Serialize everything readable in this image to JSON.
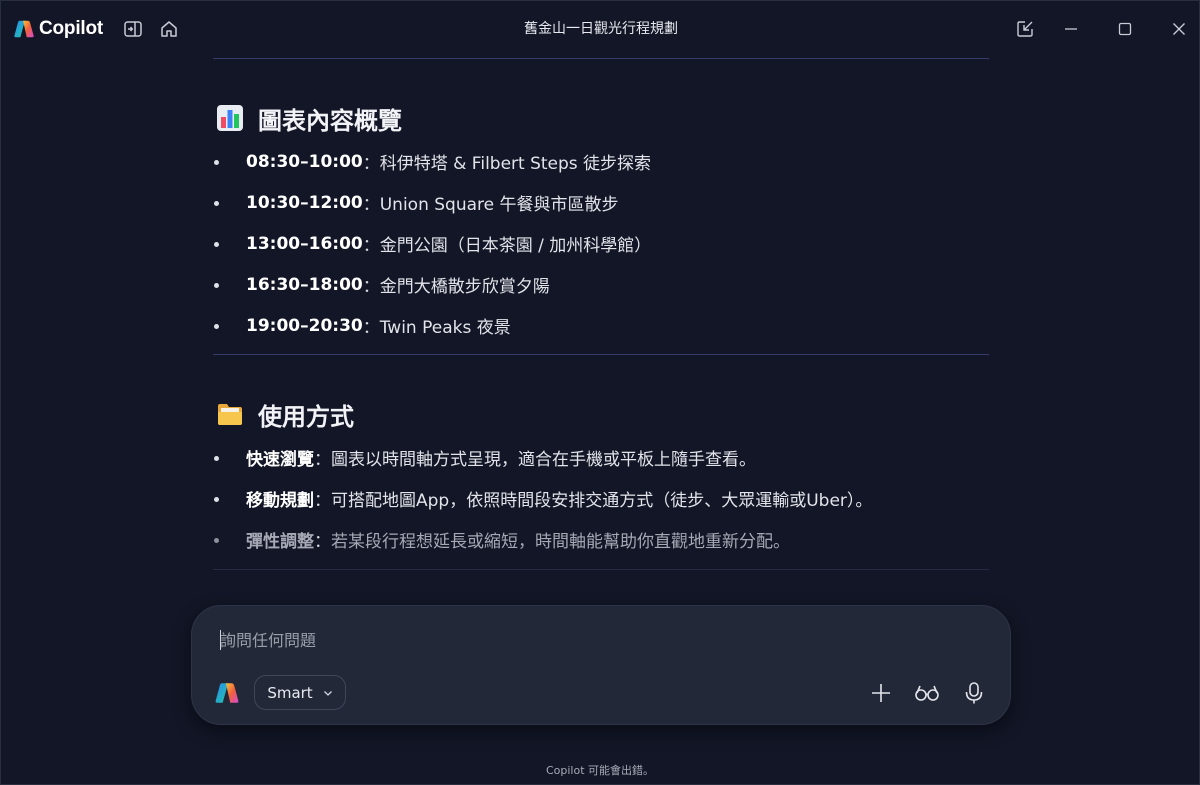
{
  "app": {
    "name": "Copilot",
    "window_title": "舊金山一日觀光行程規劃"
  },
  "sections": [
    {
      "heading": "圖表內容概覽",
      "icon": "bar-chart-emoji",
      "items": [
        {
          "label": "08:30–10:00",
          "sep": "：",
          "text": "科伊特塔 & Filbert Steps 徒步探索"
        },
        {
          "label": "10:30–12:00",
          "sep": "：",
          "text": "Union Square 午餐與市區散步"
        },
        {
          "label": "13:00–16:00",
          "sep": "：",
          "text": "金門公園（日本茶園 / 加州科學館）"
        },
        {
          "label": "16:30–18:00",
          "sep": "：",
          "text": "金門大橋散步欣賞夕陽"
        },
        {
          "label": "19:00–20:30",
          "sep": "：",
          "text": "Twin Peaks 夜景"
        }
      ]
    },
    {
      "heading": "使用方式",
      "icon": "folder-emoji",
      "items": [
        {
          "label": "快速瀏覽",
          "sep": "：",
          "text": "圖表以時間軸方式呈現，適合在手機或平板上隨手查看。"
        },
        {
          "label": "移動規劃",
          "sep": "：",
          "text": "可搭配地圖App，依照時間段安排交通方式（徒步、大眾運輸或Uber）。"
        },
        {
          "label": "彈性調整",
          "sep": "：",
          "text": "若某段行程想延長或縮短，時間軸能幫助你直觀地重新分配。"
        }
      ]
    }
  ],
  "composer": {
    "placeholder": "詢問任何問題",
    "mode_label": "Smart"
  },
  "footer": "Copilot 可能會出錯。",
  "colors": {
    "background": "#121626",
    "composer": "#232838",
    "divider": "#353a6a"
  }
}
